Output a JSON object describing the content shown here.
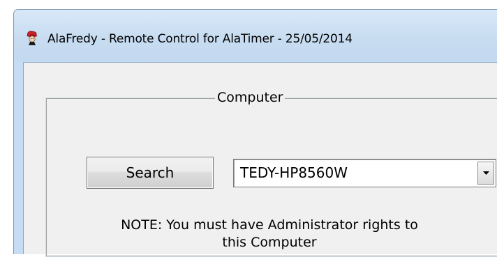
{
  "window": {
    "title": "AlaFredy - Remote Control for AlaTimer - 25/05/2014",
    "icon": "red-hat-fredy-icon"
  },
  "group": {
    "label": "Computer"
  },
  "search_button": {
    "label": "Search"
  },
  "computer_select": {
    "value": "TEDY-HP8560W",
    "arrow_icon": "dropdown-arrow-icon"
  },
  "note": {
    "line1": "NOTE: You must have Administrator rights to",
    "line2": "this Computer"
  },
  "colors": {
    "titlebar": "#c6dcf2",
    "client": "#f0f0f0",
    "icon_red": "#c8242a"
  }
}
